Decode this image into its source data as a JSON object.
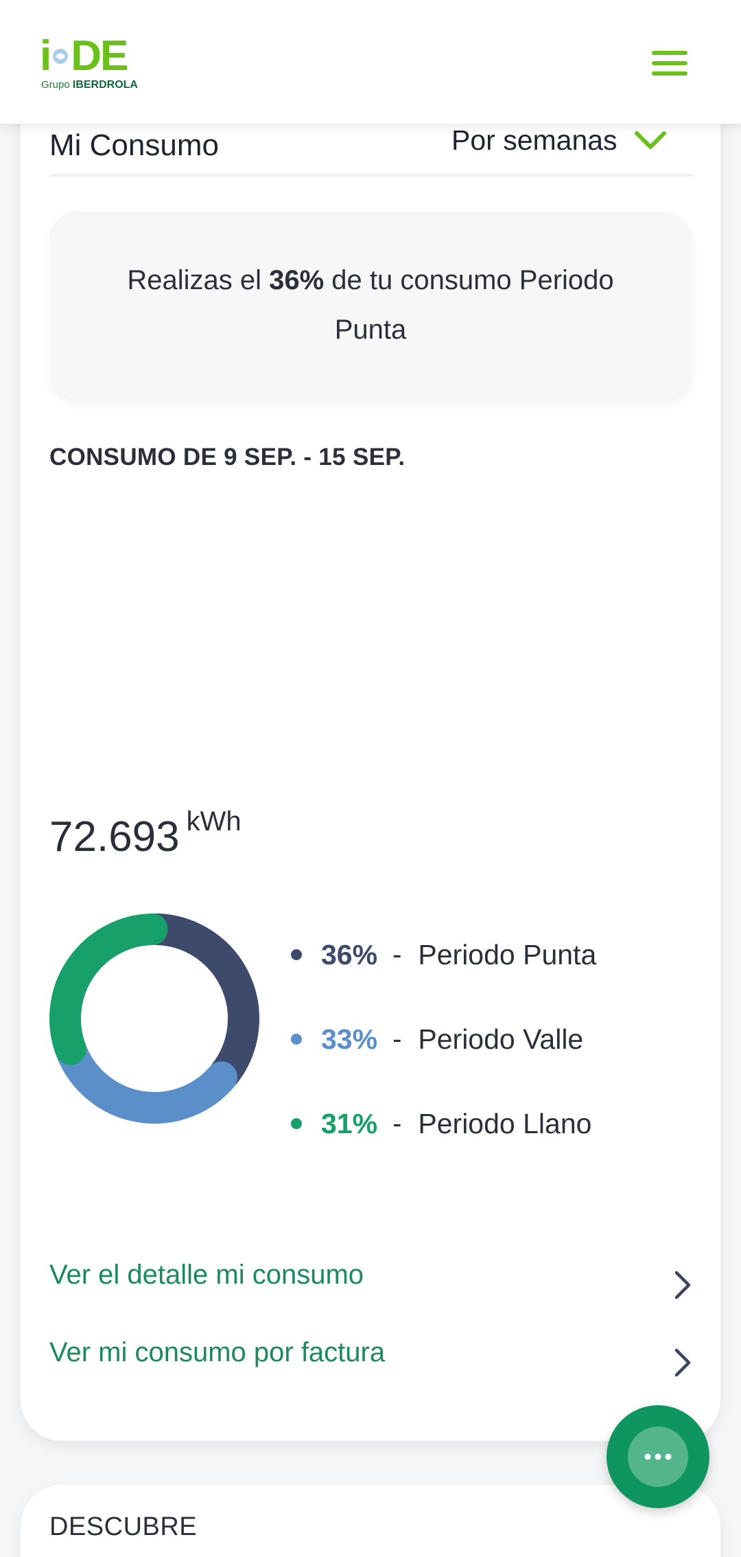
{
  "header": {
    "logo_text": "iDE",
    "logo_sub_prefix": "Grupo",
    "logo_sub_brand": "IBERDROLA",
    "menu_icon": "hamburger-menu-icon"
  },
  "consumo": {
    "title": "Mi Consumo",
    "period_selector": "Por semanas",
    "insight_prefix": "Realizas el ",
    "insight_highlight": "36%",
    "insight_suffix": " de tu consumo Periodo Punta",
    "range_title": "CONSUMO DE 9 SEP. - 15 SEP.",
    "total_value": "72.693",
    "total_unit": "kWh",
    "legend": [
      {
        "pct": "36%",
        "name": "Periodo Punta",
        "color": "#3e4a6b"
      },
      {
        "pct": "33%",
        "name": "Periodo Valle",
        "color": "#5a8fca"
      },
      {
        "pct": "31%",
        "name": "Periodo Llano",
        "color": "#17a06a"
      }
    ],
    "links": [
      {
        "label": "Ver el detalle mi consumo"
      },
      {
        "label": "Ver mi consumo por factura"
      }
    ]
  },
  "descubre": {
    "title": "DESCUBRE"
  },
  "chat": {
    "icon": "chat-bubble-icon"
  },
  "colors": {
    "brand_green": "#6bc11a",
    "link_green": "#1b8a5c",
    "fab_green": "#0e9560"
  },
  "chart_data": {
    "type": "pie",
    "categories": [
      "Periodo Punta",
      "Periodo Valle",
      "Periodo Llano"
    ],
    "values": [
      36,
      33,
      31
    ],
    "colors": [
      "#3e4a6b",
      "#5a8fca",
      "#17a06a"
    ],
    "style": "donut"
  }
}
